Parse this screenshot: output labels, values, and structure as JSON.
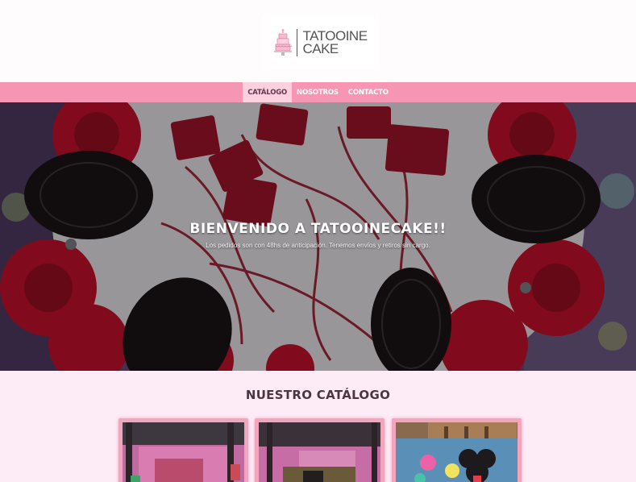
{
  "header": {
    "logo": {
      "line1": "TATOOINE",
      "line2": "CAKE"
    }
  },
  "nav": {
    "items": [
      {
        "label": "CATÁLOGO",
        "active": true
      },
      {
        "label": "NOSOTROS",
        "active": false
      },
      {
        "label": "CONTACTO",
        "active": false
      }
    ]
  },
  "hero": {
    "title": "BIENVENIDO A TATOOINECAKE!!",
    "subtitle": "Los pedidos son con 48hs de anticipación. Tenemos envíos y retiros sin cargo."
  },
  "catalog": {
    "title": "NUESTRO CATÁLOGO",
    "cards": [
      {
        "name": "catalog-card-1"
      },
      {
        "name": "catalog-card-2"
      },
      {
        "name": "catalog-card-3"
      }
    ]
  },
  "colors": {
    "nav_pink": "#f795b4",
    "page_bg": "#fdecf6",
    "card_border": "#f2a6bd"
  }
}
